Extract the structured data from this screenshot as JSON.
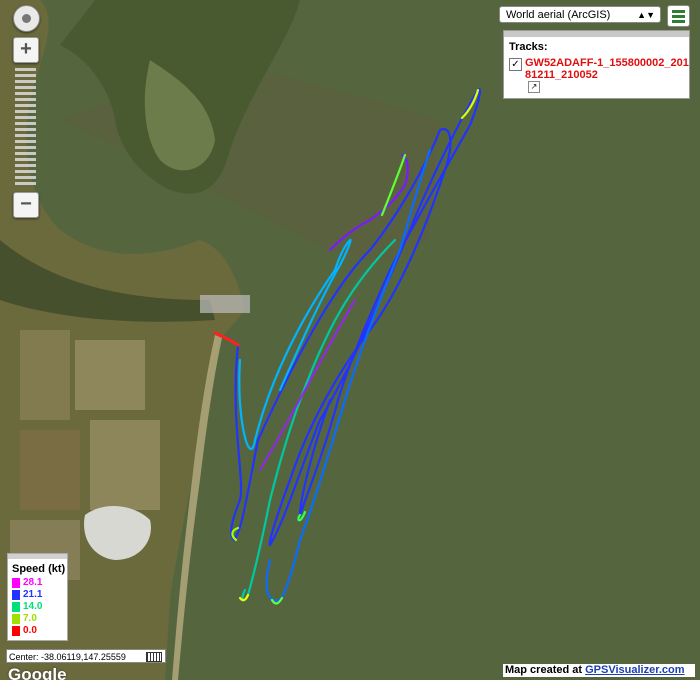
{
  "map": {
    "layer_selected": "World aerial (ArcGIS)",
    "zoom_in_label": "+",
    "zoom_out_label": "−",
    "center_label": "Center: -38.06119,147.25559",
    "credit_prefix": "Map created at ",
    "credit_link": "GPSVisualizer.com",
    "google_logo": "Google"
  },
  "tracks": {
    "title": "Tracks:",
    "items": [
      {
        "name": "GW52ADAFF-1_155800002_20181211_210052",
        "checked": true
      }
    ]
  },
  "legend": {
    "title": "Speed (kt)",
    "entries": [
      {
        "value": "28.1",
        "color": "#ff00ff"
      },
      {
        "value": "21.1",
        "color": "#2233ff"
      },
      {
        "value": "14.0",
        "color": "#00e07a"
      },
      {
        "value": "7.0",
        "color": "#9ee000"
      },
      {
        "value": "0.0",
        "color": "#ff0000"
      }
    ]
  },
  "colors": {
    "water": "#55663f",
    "land": "#6b6a3c",
    "track_fast": "#2233ff",
    "track_mid": "#00b4ff",
    "track_slow": "#00e07a"
  }
}
